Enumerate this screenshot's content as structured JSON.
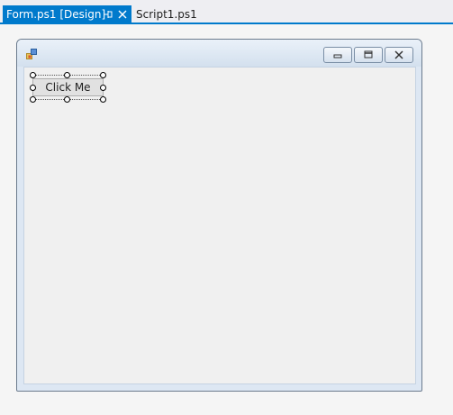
{
  "tabs": {
    "active": {
      "label": "Form.ps1 [Design]"
    },
    "inactive": {
      "label": "Script1.ps1"
    }
  },
  "form": {
    "title": "",
    "button": {
      "label": "Click Me"
    }
  },
  "colors": {
    "accent": "#007acc",
    "surface": "#f5f5f5",
    "client": "#f0f0f0"
  },
  "icons": [
    "pin-icon",
    "close-icon",
    "form-icon",
    "minimize-icon",
    "maximize-icon",
    "window-close-icon"
  ]
}
